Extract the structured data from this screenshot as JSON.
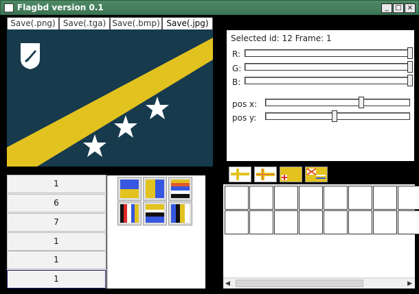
{
  "window": {
    "title": "Flagbd version 0.1"
  },
  "titlebar_buttons": {
    "minimize": "_",
    "maximize": "□",
    "close": "×"
  },
  "save_buttons": [
    "Save(.png)",
    "Save(.tga)",
    "Save(.bmp)",
    "Save(.jpg)"
  ],
  "selection": {
    "text": "Selected id: 12 Frame: 1"
  },
  "color_sliders": [
    {
      "label": "R:",
      "value": 1.0
    },
    {
      "label": "G:",
      "value": 1.0
    },
    {
      "label": "B:",
      "value": 1.0
    }
  ],
  "pos_sliders": [
    {
      "label": "pos  x:",
      "value": 0.66
    },
    {
      "label": "pos  y:",
      "value": 0.47
    }
  ],
  "frame_list": [
    "1",
    "6",
    "7",
    "1",
    "1",
    "1"
  ],
  "colors": {
    "flag_background": "#173a4d",
    "flag_stripe": "#e2c21f",
    "star": "#ffffff",
    "titlebar": "#3d7655"
  },
  "icons": {
    "app": "window-icon",
    "emblem": "shield-sword-icon",
    "stars": "star-icon"
  }
}
